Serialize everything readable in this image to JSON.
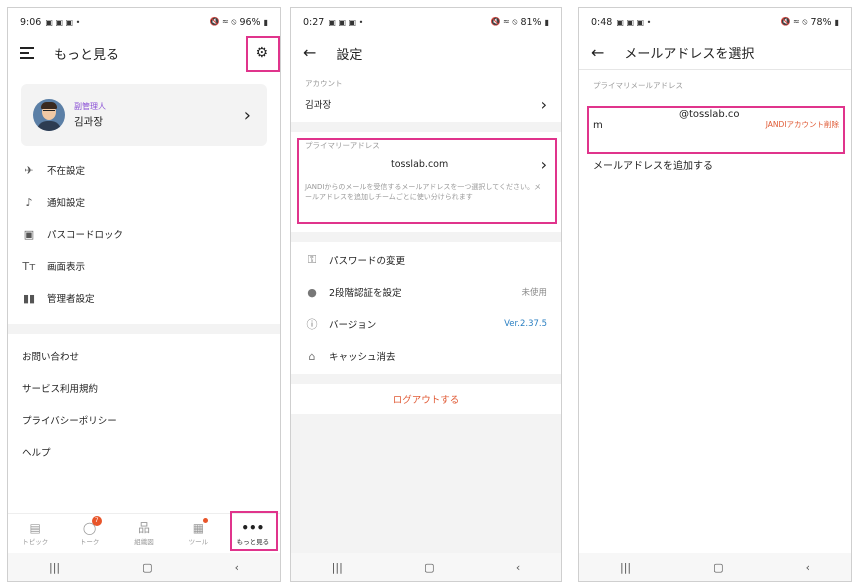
{
  "screens": [
    {
      "status": {
        "time": "9:06",
        "battery": "96%"
      },
      "title": "もっと見る",
      "profile": {
        "role": "副管理人",
        "name": "김과장"
      },
      "menu": [
        {
          "icon": "airplane-icon",
          "glyph": "✈",
          "label": "不在設定"
        },
        {
          "icon": "bell-icon",
          "glyph": "🔔",
          "label": "通知設定"
        },
        {
          "icon": "lock-icon",
          "glyph": "🔒",
          "label": "パスコードロック"
        },
        {
          "icon": "text-size-icon",
          "glyph": "Tт",
          "label": "画面表示"
        },
        {
          "icon": "bar-chart-icon",
          "glyph": "▮",
          "label": "管理者設定"
        }
      ],
      "links": [
        "お問い合わせ",
        "サービス利用規約",
        "プライバシーポリシー",
        "ヘルプ"
      ],
      "bottom_nav": [
        {
          "icon": "topic-icon",
          "glyph": "▤",
          "label": "トピック"
        },
        {
          "icon": "talk-icon",
          "glyph": "◯",
          "label": "トーク",
          "badge": "7"
        },
        {
          "icon": "org-chart-icon",
          "glyph": "品",
          "label": "組織図"
        },
        {
          "icon": "tools-icon",
          "glyph": "▦",
          "label": "ツール"
        },
        {
          "icon": "more-icon",
          "glyph": "•••",
          "label": "もっと見る"
        }
      ]
    },
    {
      "status": {
        "time": "0:27",
        "battery": "81%"
      },
      "title": "設定",
      "account_label": "アカウント",
      "account_name": "김과장",
      "primary_label": "プライマリーアドレス",
      "primary_value": "tosslab.com",
      "primary_desc": "JANDIからのメールを受信するメールアドレスを一つ選択してください。メールアドレスを追加しチームごとに使い分けられます",
      "settings": [
        {
          "icon": "key-icon",
          "glyph": "⚿",
          "label": "パスワードの変更",
          "value": ""
        },
        {
          "icon": "shield-icon",
          "glyph": "●",
          "label": "2段階認証を設定",
          "value": "未使用"
        },
        {
          "icon": "info-icon",
          "glyph": "ⓘ",
          "label": "バージョン",
          "value": "Ver.2.37.5"
        },
        {
          "icon": "broom-icon",
          "glyph": "⌂",
          "label": "キャッシュ消去",
          "value": ""
        }
      ],
      "logout": "ログアウトする"
    },
    {
      "status": {
        "time": "0:48",
        "battery": "78%"
      },
      "title": "メールアドレスを選択",
      "section_label": "プライマリメールアドレス",
      "email_line1": "@tosslab.co",
      "email_line2": "m",
      "delete_label": "JANDIアカウント削除",
      "add_label": "メールアドレスを追加する"
    }
  ]
}
